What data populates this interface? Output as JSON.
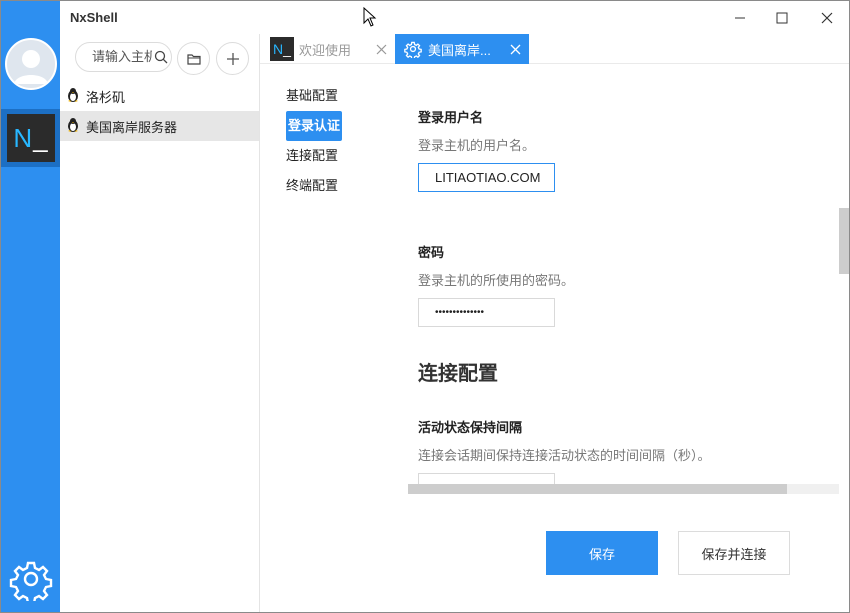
{
  "window": {
    "title": "NxShell"
  },
  "rail": {
    "app_glyph": "N",
    "app_glyph_suffix": "_",
    "settings_icon": "gear-icon",
    "avatar_icon": "user-avatar-icon"
  },
  "host_panel": {
    "search_placeholder": "请输入主机",
    "search_icon": "search-icon",
    "folder_icon": "folder-icon",
    "add_icon": "plus-icon",
    "hosts": [
      {
        "label": "洛杉矶",
        "icon": "linux-penguin-icon",
        "selected": false
      },
      {
        "label": "美国离岸服务器",
        "icon": "linux-penguin-icon",
        "selected": true
      }
    ]
  },
  "tabs": [
    {
      "label": "欢迎使用",
      "icon": "nxshell-logo-icon",
      "active": false
    },
    {
      "label": "美国离岸...",
      "icon": "gear-icon",
      "active": true
    }
  ],
  "settings_nav": [
    {
      "label": "基础配置",
      "active": false
    },
    {
      "label": "登录认证",
      "active": true
    },
    {
      "label": "连接配置",
      "active": false
    },
    {
      "label": "终端配置",
      "active": false
    }
  ],
  "form": {
    "username": {
      "title": "登录用户名",
      "desc": "登录主机的用户名。",
      "value": "LITIAOTIAO.COM"
    },
    "password": {
      "title": "密码",
      "desc": "登录主机的所使用的密码。",
      "value": "••••••••••••••"
    },
    "section_heading": "连接配置",
    "keepalive": {
      "title": "活动状态保持间隔",
      "desc": "连接会话期间保持连接活动状态的时间间隔（秒）。"
    }
  },
  "actions": {
    "save": "保存",
    "save_connect": "保存并连接"
  },
  "colors": {
    "accent": "#2d8ff0",
    "rail_active": "#1c6fc4",
    "logo_bg": "#2b2b2b",
    "logo_fg": "#28b7ff"
  }
}
